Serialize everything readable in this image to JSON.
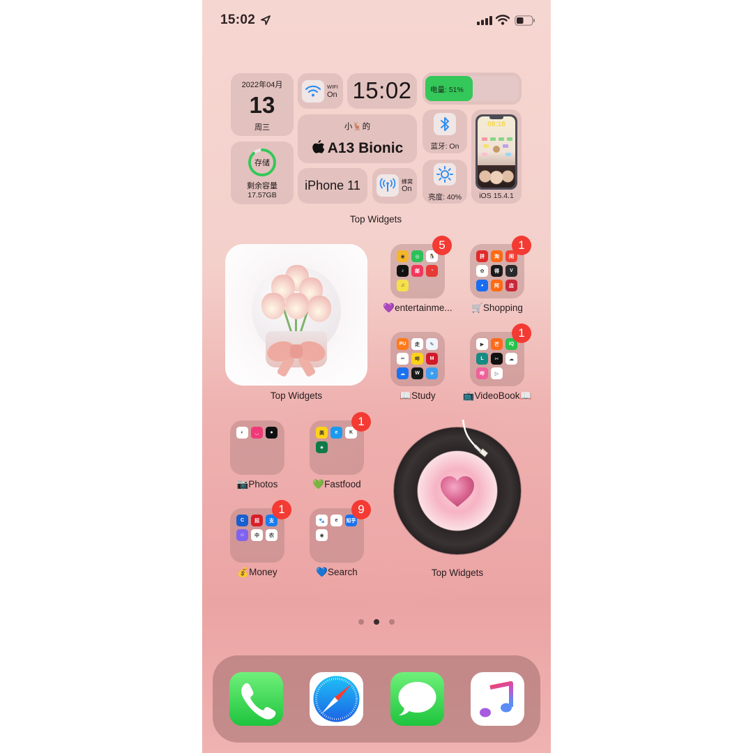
{
  "status_bar": {
    "time": "15:02",
    "location_icon": "location-arrow-icon",
    "signal_icon": "cellular-signal-icon",
    "wifi_icon": "wifi-icon",
    "battery_icon": "battery-icon",
    "battery_level_fraction": 0.45
  },
  "widgets": {
    "date": {
      "year_month": "2022年04月",
      "day": "13",
      "weekday": "周三"
    },
    "storage": {
      "ring_label": "存储",
      "label": "剩余容量",
      "value": "17.57GB",
      "used_fraction": 0.88,
      "ring_color": "#34c759"
    },
    "wifi": {
      "label": "WIFI",
      "status": "On",
      "icon": "wifi-icon",
      "icon_color": "#2f8ef0"
    },
    "clock": {
      "time": "15:02"
    },
    "battery": {
      "label": "电量: 51%",
      "level_percent": 51,
      "fill_color": "#34c759"
    },
    "chip": {
      "owner": "小🦌的",
      "chip_name": "A13 Bionic"
    },
    "bluetooth": {
      "label": "蓝牙: On",
      "icon": "bluetooth-icon"
    },
    "brightness": {
      "label": "亮度: 40%",
      "icon": "sun-icon",
      "level_percent": 40
    },
    "ios": {
      "label": "iOS 15.4.1",
      "mini_clock": "08:18"
    },
    "model": {
      "name": "iPhone 11"
    },
    "cellular": {
      "label": "蜂窝",
      "status": "On",
      "icon": "cellular-antenna-icon"
    },
    "stack_label": "Top Widgets"
  },
  "tulip_widget": {
    "label": "Top Widgets"
  },
  "record_widget": {
    "label": "Top Widgets"
  },
  "folders": [
    {
      "name": "💜entertainme...",
      "badge": "5",
      "apps": [
        {
          "name": "weibo",
          "color": "#f5b52a",
          "glyph": "◉"
        },
        {
          "name": "wechat",
          "color": "#2dc05a",
          "glyph": "◎"
        },
        {
          "name": "qq",
          "color": "#ffffff",
          "glyph": "🐧"
        },
        {
          "name": "douyin",
          "color": "#111111",
          "glyph": "♪"
        },
        {
          "name": "netease-mail",
          "color": "#f0385c",
          "glyph": "邮"
        },
        {
          "name": "netease-music",
          "color": "#e63a36",
          "glyph": "◔"
        },
        {
          "name": "qq-music",
          "color": "#f5e04a",
          "glyph": "♫"
        }
      ]
    },
    {
      "name": "🛒Shopping",
      "badge": "1",
      "apps": [
        {
          "name": "pinduoduo",
          "color": "#e02b2b",
          "glyph": "拼"
        },
        {
          "name": "taobao",
          "color": "#ff6a12",
          "glyph": "淘"
        },
        {
          "name": "xianyu",
          "color": "#f04235",
          "glyph": "闲"
        },
        {
          "name": "meituan-flower",
          "color": "#ffffff",
          "glyph": "✿"
        },
        {
          "name": "dewu",
          "color": "#1a1a1a",
          "glyph": "得"
        },
        {
          "name": "vipshop",
          "color": "#2a2a2a",
          "glyph": "V"
        },
        {
          "name": "jd",
          "color": "#1a6cf0",
          "glyph": "◕"
        },
        {
          "name": "alibaba",
          "color": "#ff6a12",
          "glyph": "阿"
        },
        {
          "name": "store",
          "color": "#c8283a",
          "glyph": "店"
        }
      ]
    },
    {
      "name": "📖Study",
      "badge": null,
      "apps": [
        {
          "name": "pu",
          "color": "#ff7a1a",
          "glyph": "PU"
        },
        {
          "name": "keep",
          "color": "#ffffff",
          "glyph": "走"
        },
        {
          "name": "draw",
          "color": "#f0f4ff",
          "glyph": "✎"
        },
        {
          "name": "infinity",
          "color": "#ffffff",
          "glyph": "∞"
        },
        {
          "name": "bili-study",
          "color": "#ffd21a",
          "glyph": "哔"
        },
        {
          "name": "mm",
          "color": "#d11a2a",
          "glyph": "M"
        },
        {
          "name": "cloud",
          "color": "#1a72f0",
          "glyph": "☁"
        },
        {
          "name": "word",
          "color": "#1a1a1a",
          "glyph": "W"
        },
        {
          "name": "bird",
          "color": "#3d9df0",
          "glyph": "✈"
        }
      ]
    },
    {
      "name": "📺VideoBook📖",
      "badge": "1",
      "apps": [
        {
          "name": "tencent-video",
          "color": "#ffffff",
          "glyph": "▶"
        },
        {
          "name": "mango",
          "color": "#ff6a1a",
          "glyph": "芒"
        },
        {
          "name": "iqiyi",
          "color": "#27c24c",
          "glyph": "iQ"
        },
        {
          "name": "l-app",
          "color": "#178b82",
          "glyph": "L"
        },
        {
          "name": "capcut",
          "color": "#111111",
          "glyph": "✂"
        },
        {
          "name": "baidu-netdisk",
          "color": "#ffffff",
          "glyph": "☁"
        },
        {
          "name": "bilibili",
          "color": "#f0609a",
          "glyph": "哔"
        },
        {
          "name": "video-player",
          "color": "#ffffff",
          "glyph": "▷"
        }
      ]
    },
    {
      "name": "📷Photos",
      "badge": null,
      "apps": [
        {
          "name": "camera-app",
          "color": "#ffffff",
          "glyph": "◐"
        },
        {
          "name": "beauty-cam",
          "color": "#f03a78",
          "glyph": "◡"
        },
        {
          "name": "green-cam",
          "color": "#111111",
          "glyph": "●"
        }
      ]
    },
    {
      "name": "💚Fastfood",
      "badge": "1",
      "apps": [
        {
          "name": "meituan",
          "color": "#ffd21a",
          "glyph": "美"
        },
        {
          "name": "eleme",
          "color": "#1a9bf0",
          "glyph": "e"
        },
        {
          "name": "kfc",
          "color": "#ffffff",
          "glyph": "K"
        },
        {
          "name": "starbucks",
          "color": "#0f7a48",
          "glyph": "★"
        }
      ]
    },
    {
      "name": "💰Money",
      "badge": "1",
      "apps": [
        {
          "name": "ccb",
          "color": "#1a5fd0",
          "glyph": "C"
        },
        {
          "name": "cmb",
          "color": "#d6202a",
          "glyph": "招"
        },
        {
          "name": "alipay",
          "color": "#1a7cf0",
          "glyph": "支"
        },
        {
          "name": "duck",
          "color": "#7f63f0",
          "glyph": "☺"
        },
        {
          "name": "boc",
          "color": "#ffffff",
          "glyph": "中"
        },
        {
          "name": "abc",
          "color": "#ffffff",
          "glyph": "农"
        }
      ]
    },
    {
      "name": "💙Search",
      "badge": "9",
      "apps": [
        {
          "name": "baidu",
          "color": "#ffffff",
          "glyph": "🐾"
        },
        {
          "name": "edge",
          "color": "#ffffff",
          "glyph": "e"
        },
        {
          "name": "zhihu",
          "color": "#1a72f0",
          "glyph": "知乎"
        },
        {
          "name": "quark",
          "color": "#ffffff",
          "glyph": "◉"
        }
      ]
    }
  ],
  "page_indicator": {
    "pages": 3,
    "current": 2
  },
  "dock": [
    {
      "name": "Phone",
      "icon": "phone-icon"
    },
    {
      "name": "Safari",
      "icon": "compass-icon"
    },
    {
      "name": "Messages",
      "icon": "speech-bubble-icon"
    },
    {
      "name": "Music",
      "icon": "music-note-icon"
    }
  ]
}
